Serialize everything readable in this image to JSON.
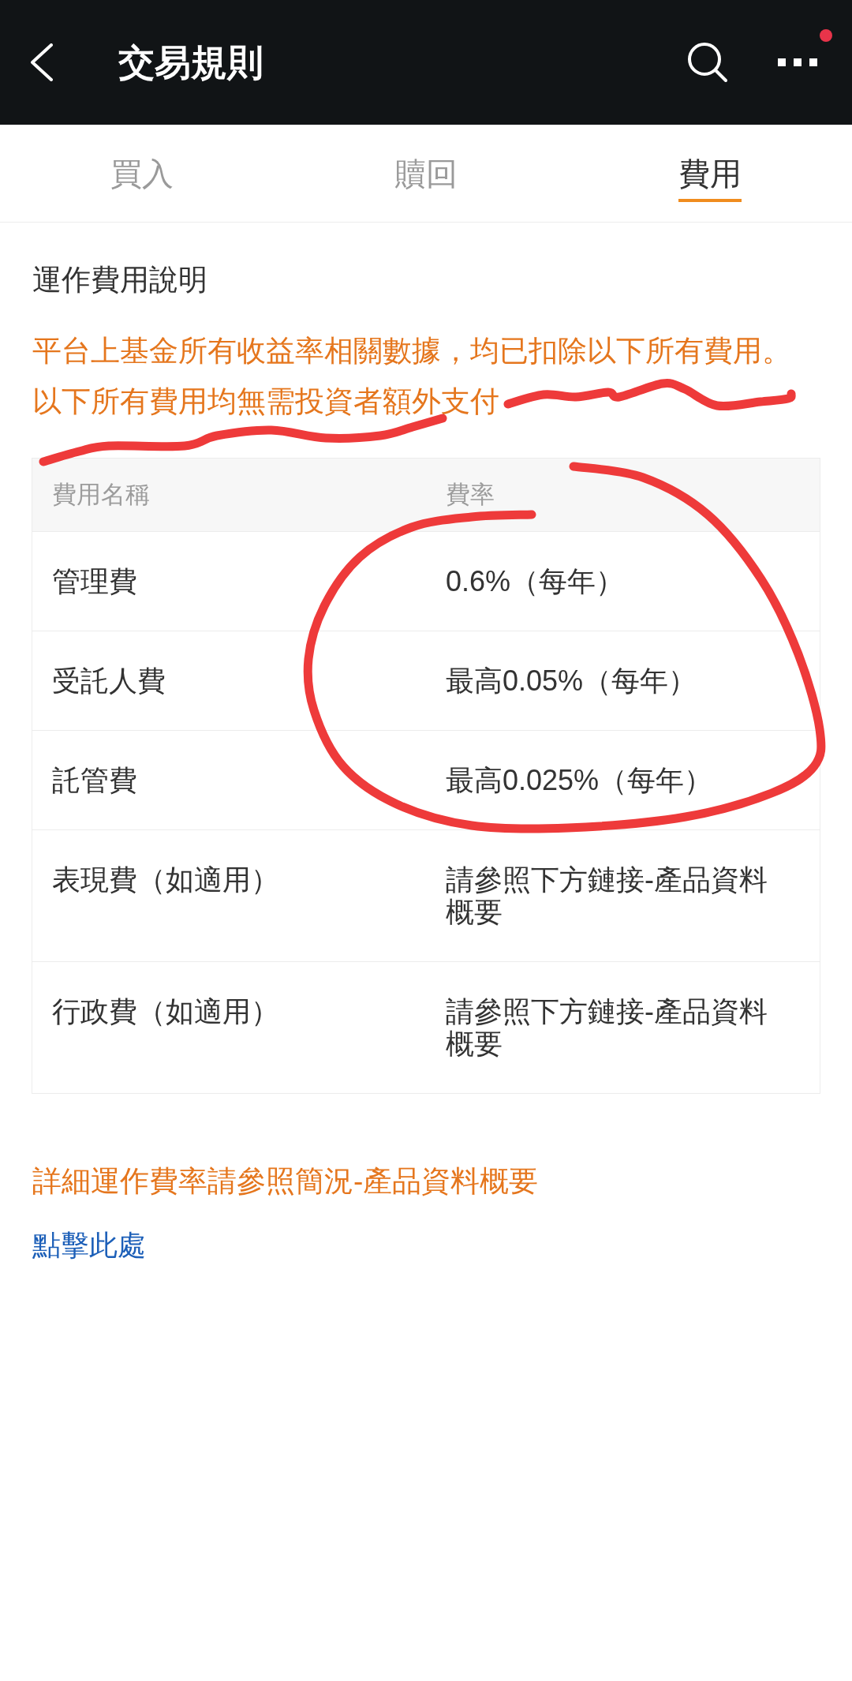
{
  "header": {
    "title": "交易規則",
    "notification_dot": true
  },
  "tabs": [
    {
      "label": "買入",
      "selected": false
    },
    {
      "label": "贖回",
      "selected": false
    },
    {
      "label": "費用",
      "selected": true
    }
  ],
  "section": {
    "title": "運作費用說明",
    "notice": [
      "平台上基金所有收益率相關數據，均已扣除以下所有費用。",
      "以下所有費用均無需投資者額外支付"
    ]
  },
  "fee_table": {
    "columns": [
      "費用名稱",
      "費率"
    ],
    "rows": [
      {
        "name": "管理費",
        "rate": "0.6%（每年）"
      },
      {
        "name": "受託人費",
        "rate": "最高0.05%（每年）"
      },
      {
        "name": "託管費",
        "rate": "最高0.025%（每年）"
      },
      {
        "name": "表現費（如適用）",
        "rate": "請參照下方鏈接-產品資料概要"
      },
      {
        "name": "行政費（如適用）",
        "rate": "請參照下方鏈接-產品資料概要"
      }
    ]
  },
  "footer_note": "詳細運作費率請參照簡況-產品資料概要",
  "link": "點擊此處",
  "annotations": [
    {
      "kind": "underline"
    },
    {
      "kind": "underline"
    },
    {
      "kind": "circle"
    }
  ]
}
